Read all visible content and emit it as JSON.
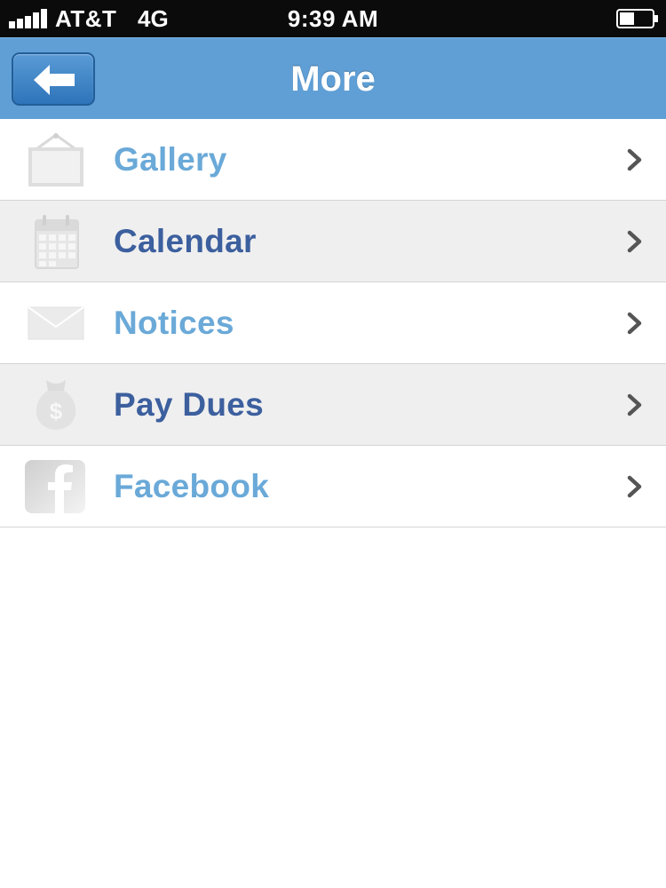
{
  "status_bar": {
    "carrier": "AT&T",
    "network": "4G",
    "time": "9:39 AM"
  },
  "nav": {
    "title": "More",
    "back_icon": "left-arrow-icon"
  },
  "menu": {
    "items": [
      {
        "label": "Gallery",
        "icon": "picture-frame-icon",
        "color": "#6aa9d8"
      },
      {
        "label": "Calendar",
        "icon": "calendar-icon",
        "color": "#3c5f9e"
      },
      {
        "label": "Notices",
        "icon": "envelope-icon",
        "color": "#6aa9d8"
      },
      {
        "label": "Pay Dues",
        "icon": "money-bag-icon",
        "color": "#3c5f9e"
      },
      {
        "label": "Facebook",
        "icon": "facebook-icon",
        "color": "#6aa9d8"
      }
    ]
  },
  "colors": {
    "nav_background": "#5f9fd6",
    "status_background": "#0b0b0b",
    "chevron": "#555555"
  }
}
